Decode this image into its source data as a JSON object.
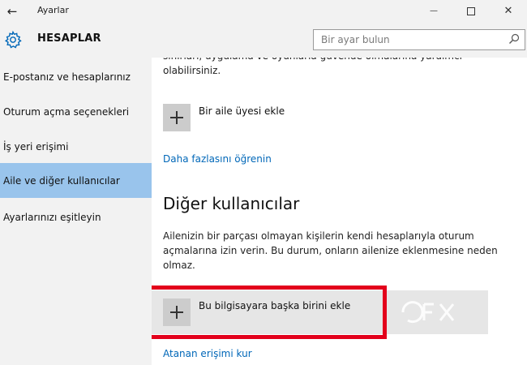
{
  "window": {
    "title": "Ayarlar",
    "back_icon": "←",
    "minimize_icon": "—",
    "close_icon": "✕"
  },
  "header": {
    "title": "HESAPLAR",
    "search_placeholder": "Bir ayar bulun"
  },
  "sidebar": {
    "items": [
      {
        "label": "E-postanız ve hesaplarınız",
        "selected": false
      },
      {
        "label": "Oturum açma seçenekleri",
        "selected": false
      },
      {
        "label": "İş yeri erişimi",
        "selected": false
      },
      {
        "label": "Aile ve diğer kullanıcılar",
        "selected": true
      },
      {
        "label": "Ayarlarınızı eşitleyin",
        "selected": false
      }
    ]
  },
  "content": {
    "intro_text": "sınırları, uygulama ve oyunlarla güvende olmalarına yardımcı olabilirsiniz.",
    "add_family_label": "Bir aile üyesi ekle",
    "learn_more_link": "Daha fazlasını öğrenin",
    "other_users_title": "Diğer kullanıcılar",
    "other_users_desc": "Ailenizin bir parçası olmayan kişilerin kendi hesaplarıyla oturum açmalarına izin verin. Bu durum, onların ailenize eklenmesine neden olmaz.",
    "add_other_label": "Bu bilgisayara başka birini ekle",
    "assigned_access_link": "Atanan erişimi kur"
  },
  "colors": {
    "accent": "#0067b8",
    "selected_nav": "#99c4ec",
    "highlight": "#e3001b",
    "chrome": "#f2f2f2"
  }
}
